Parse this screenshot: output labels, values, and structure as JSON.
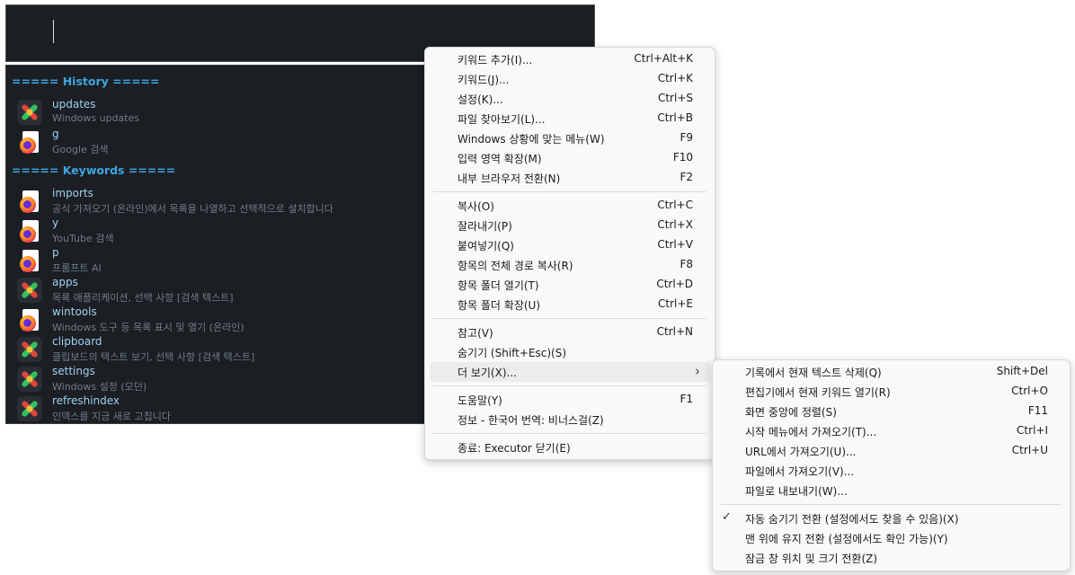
{
  "history_header": "===== History =====",
  "keywords_header": "===== Keywords =====",
  "history": [
    {
      "title": "updates",
      "sub": "Windows updates",
      "icon": "app-icon"
    },
    {
      "title": "g",
      "sub": "Google 검색",
      "icon": "firefox-icon"
    }
  ],
  "keywords": [
    {
      "title": "imports",
      "sub": "공식 가져오기 (온라인)에서 목록을 나열하고 선택적으로 설치합니다",
      "icon": "firefox-icon"
    },
    {
      "title": "y",
      "sub": "YouTube 검색",
      "icon": "firefox-icon"
    },
    {
      "title": "p",
      "sub": "프롬프트 AI",
      "icon": "firefox-icon"
    },
    {
      "title": "apps",
      "sub": "목록 애플리케이션, 선택 사항 [검색 텍스트]",
      "icon": "app-icon"
    },
    {
      "title": "wintools",
      "sub": "Windows 도구 등 목록 표시 및 열기 (온라인)",
      "icon": "firefox-icon"
    },
    {
      "title": "clipboard",
      "sub": "클립보드의 텍스트 보기, 선택 사항 [검색 텍스트]",
      "icon": "app-icon"
    },
    {
      "title": "settings",
      "sub": "Windows 설정 (모던)",
      "icon": "app-icon"
    },
    {
      "title": "refreshindex",
      "sub": "인덱스를 지금 새로 고칩니다",
      "icon": "app-icon"
    }
  ],
  "context_menu": [
    {
      "label": "키워드 추가(I)...",
      "shortcut": "Ctrl+Alt+K"
    },
    {
      "label": "키워드(J)...",
      "shortcut": "Ctrl+K"
    },
    {
      "label": "설정(K)...",
      "shortcut": "Ctrl+S"
    },
    {
      "label": "파일 찾아보기(L)...",
      "shortcut": "Ctrl+B"
    },
    {
      "label": "Windows 상황에 맞는 메뉴(W)",
      "shortcut": "F9"
    },
    {
      "label": "입력 영역 확장(M)",
      "shortcut": "F10"
    },
    {
      "label": "내부 브라우저 전환(N)",
      "shortcut": "F2"
    },
    {
      "label": "복사(O)",
      "shortcut": "Ctrl+C"
    },
    {
      "label": "잘라내기(P)",
      "shortcut": "Ctrl+X"
    },
    {
      "label": "붙여넣기(Q)",
      "shortcut": "Ctrl+V"
    },
    {
      "label": "항목의 전체 경로 복사(R)",
      "shortcut": "F8"
    },
    {
      "label": "항목 폴더 열기(T)",
      "shortcut": "Ctrl+D"
    },
    {
      "label": "항목 폴더 확장(U)",
      "shortcut": "Ctrl+E"
    },
    {
      "label": "참고(V)",
      "shortcut": "Ctrl+N"
    },
    {
      "label": "숨기기 (Shift+Esc)(S)",
      "shortcut": ""
    },
    {
      "label": "더 보기(X)...",
      "shortcut": "",
      "submenu": true,
      "highlighted": true
    },
    {
      "label": "도움말(Y)",
      "shortcut": "F1"
    },
    {
      "label": "정보 - 한국어 번역: 비너스걸(Z)",
      "shortcut": ""
    },
    {
      "label": "종료:  Executor 닫기(E)",
      "shortcut": ""
    }
  ],
  "submenu": [
    {
      "label": "기록에서 현재 텍스트 삭제(Q)",
      "shortcut": "Shift+Del"
    },
    {
      "label": "편집기에서 현재 키워드 열기(R)",
      "shortcut": "Ctrl+O"
    },
    {
      "label": "화면 중앙에 정렬(S)",
      "shortcut": "F11"
    },
    {
      "label": "시작 메뉴에서 가져오기(T)...",
      "shortcut": "Ctrl+I"
    },
    {
      "label": "URL에서 가져오기(U)...",
      "shortcut": "Ctrl+U"
    },
    {
      "label": "파일에서 가져오기(V)...",
      "shortcut": ""
    },
    {
      "label": "파일로 내보내기(W)...",
      "shortcut": ""
    },
    {
      "label": "자동 숨기기 전환 (설정에서도 찾을 수 있음)(X)",
      "shortcut": "",
      "checked": true
    },
    {
      "label": "맨 위에 유지 전환 (설정에서도 확인 가능)(Y)",
      "shortcut": ""
    },
    {
      "label": "잠금 창 위치 및 크기 전환(Z)",
      "shortcut": ""
    }
  ]
}
